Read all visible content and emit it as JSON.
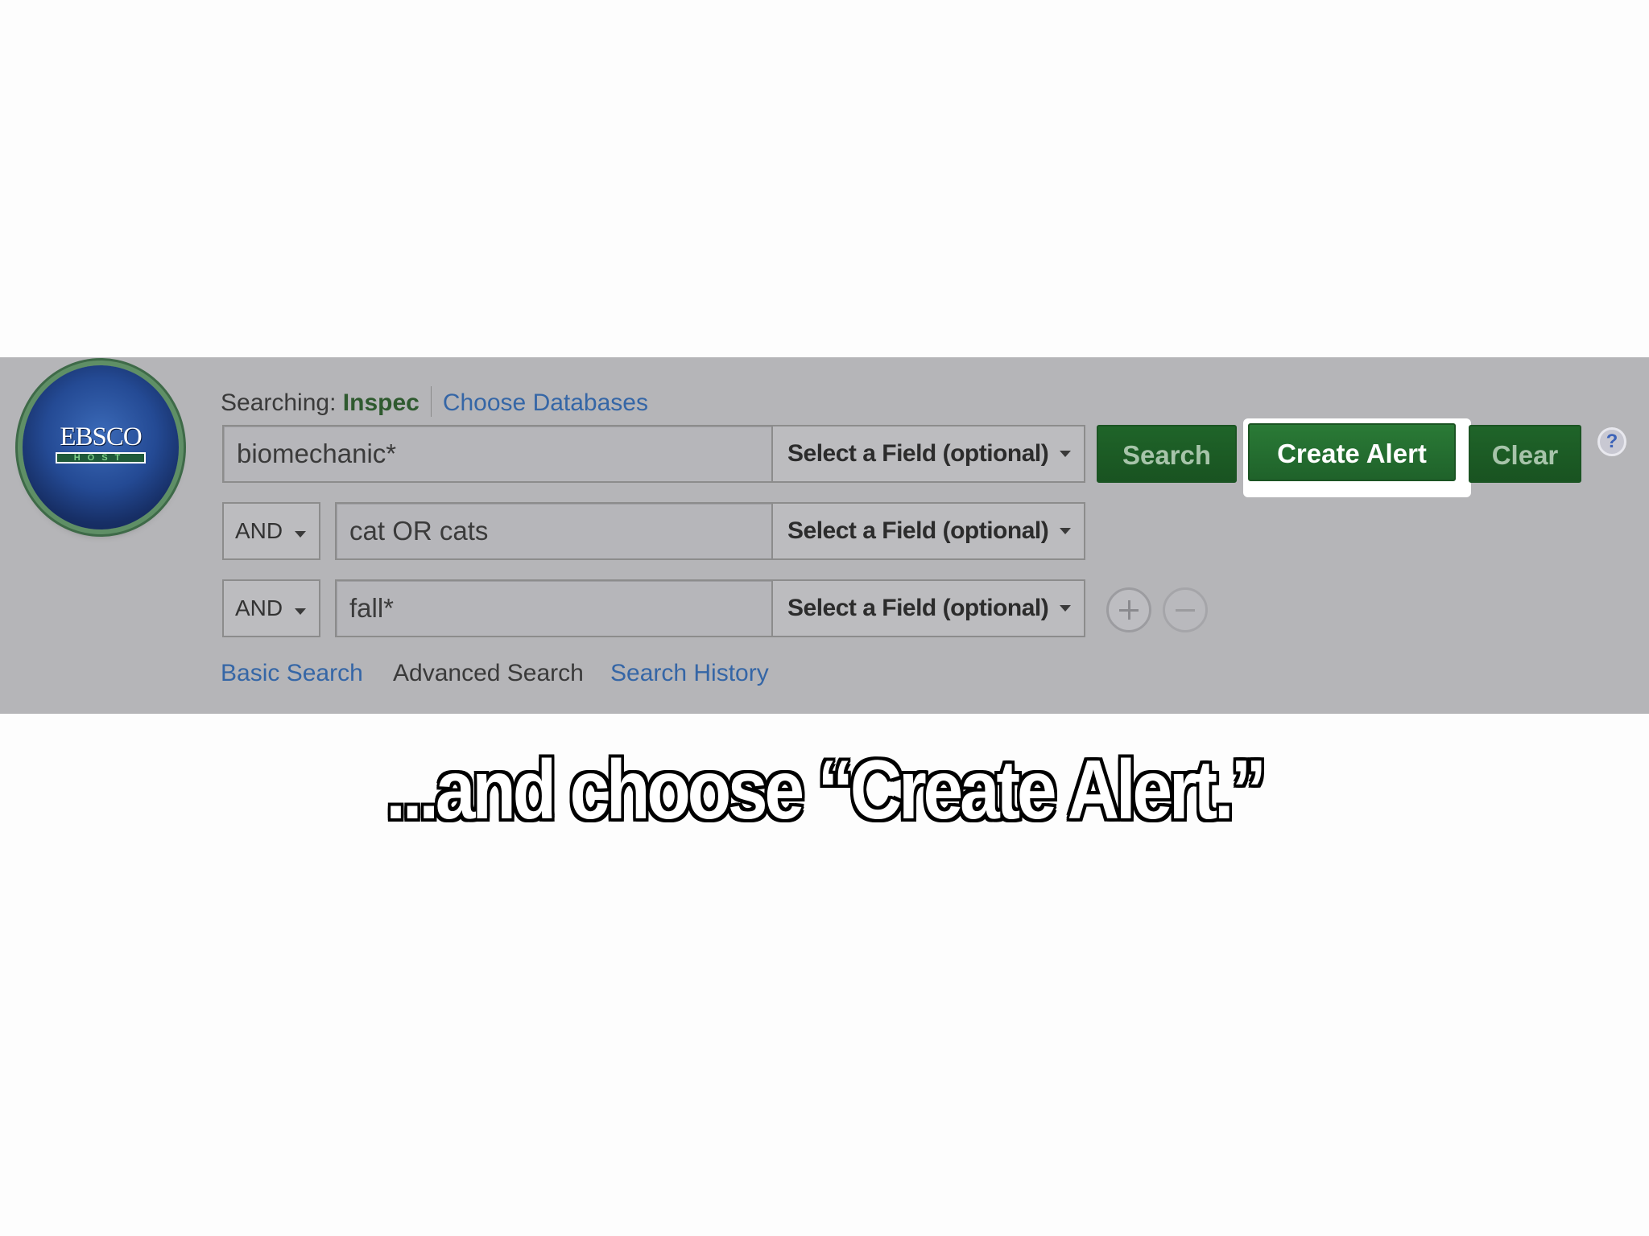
{
  "logo": {
    "word": "EBSCO",
    "sub": "HOST"
  },
  "searching": {
    "label": "Searching:",
    "database": "Inspec",
    "choose_link": "Choose Databases"
  },
  "rows": [
    {
      "bool": "",
      "text": "biomechanic*",
      "field": "Select a Field (optional)"
    },
    {
      "bool": "AND",
      "text": "cat OR cats",
      "field": "Select a Field (optional)"
    },
    {
      "bool": "AND",
      "text": "fall*",
      "field": "Select a Field (optional)"
    }
  ],
  "buttons": {
    "search": "Search",
    "create_alert": "Create Alert",
    "clear": "Clear",
    "help": "?"
  },
  "nav": {
    "basic": "Basic Search",
    "advanced": "Advanced Search",
    "history": "Search History"
  },
  "caption": "...and choose “Create Alert.”"
}
